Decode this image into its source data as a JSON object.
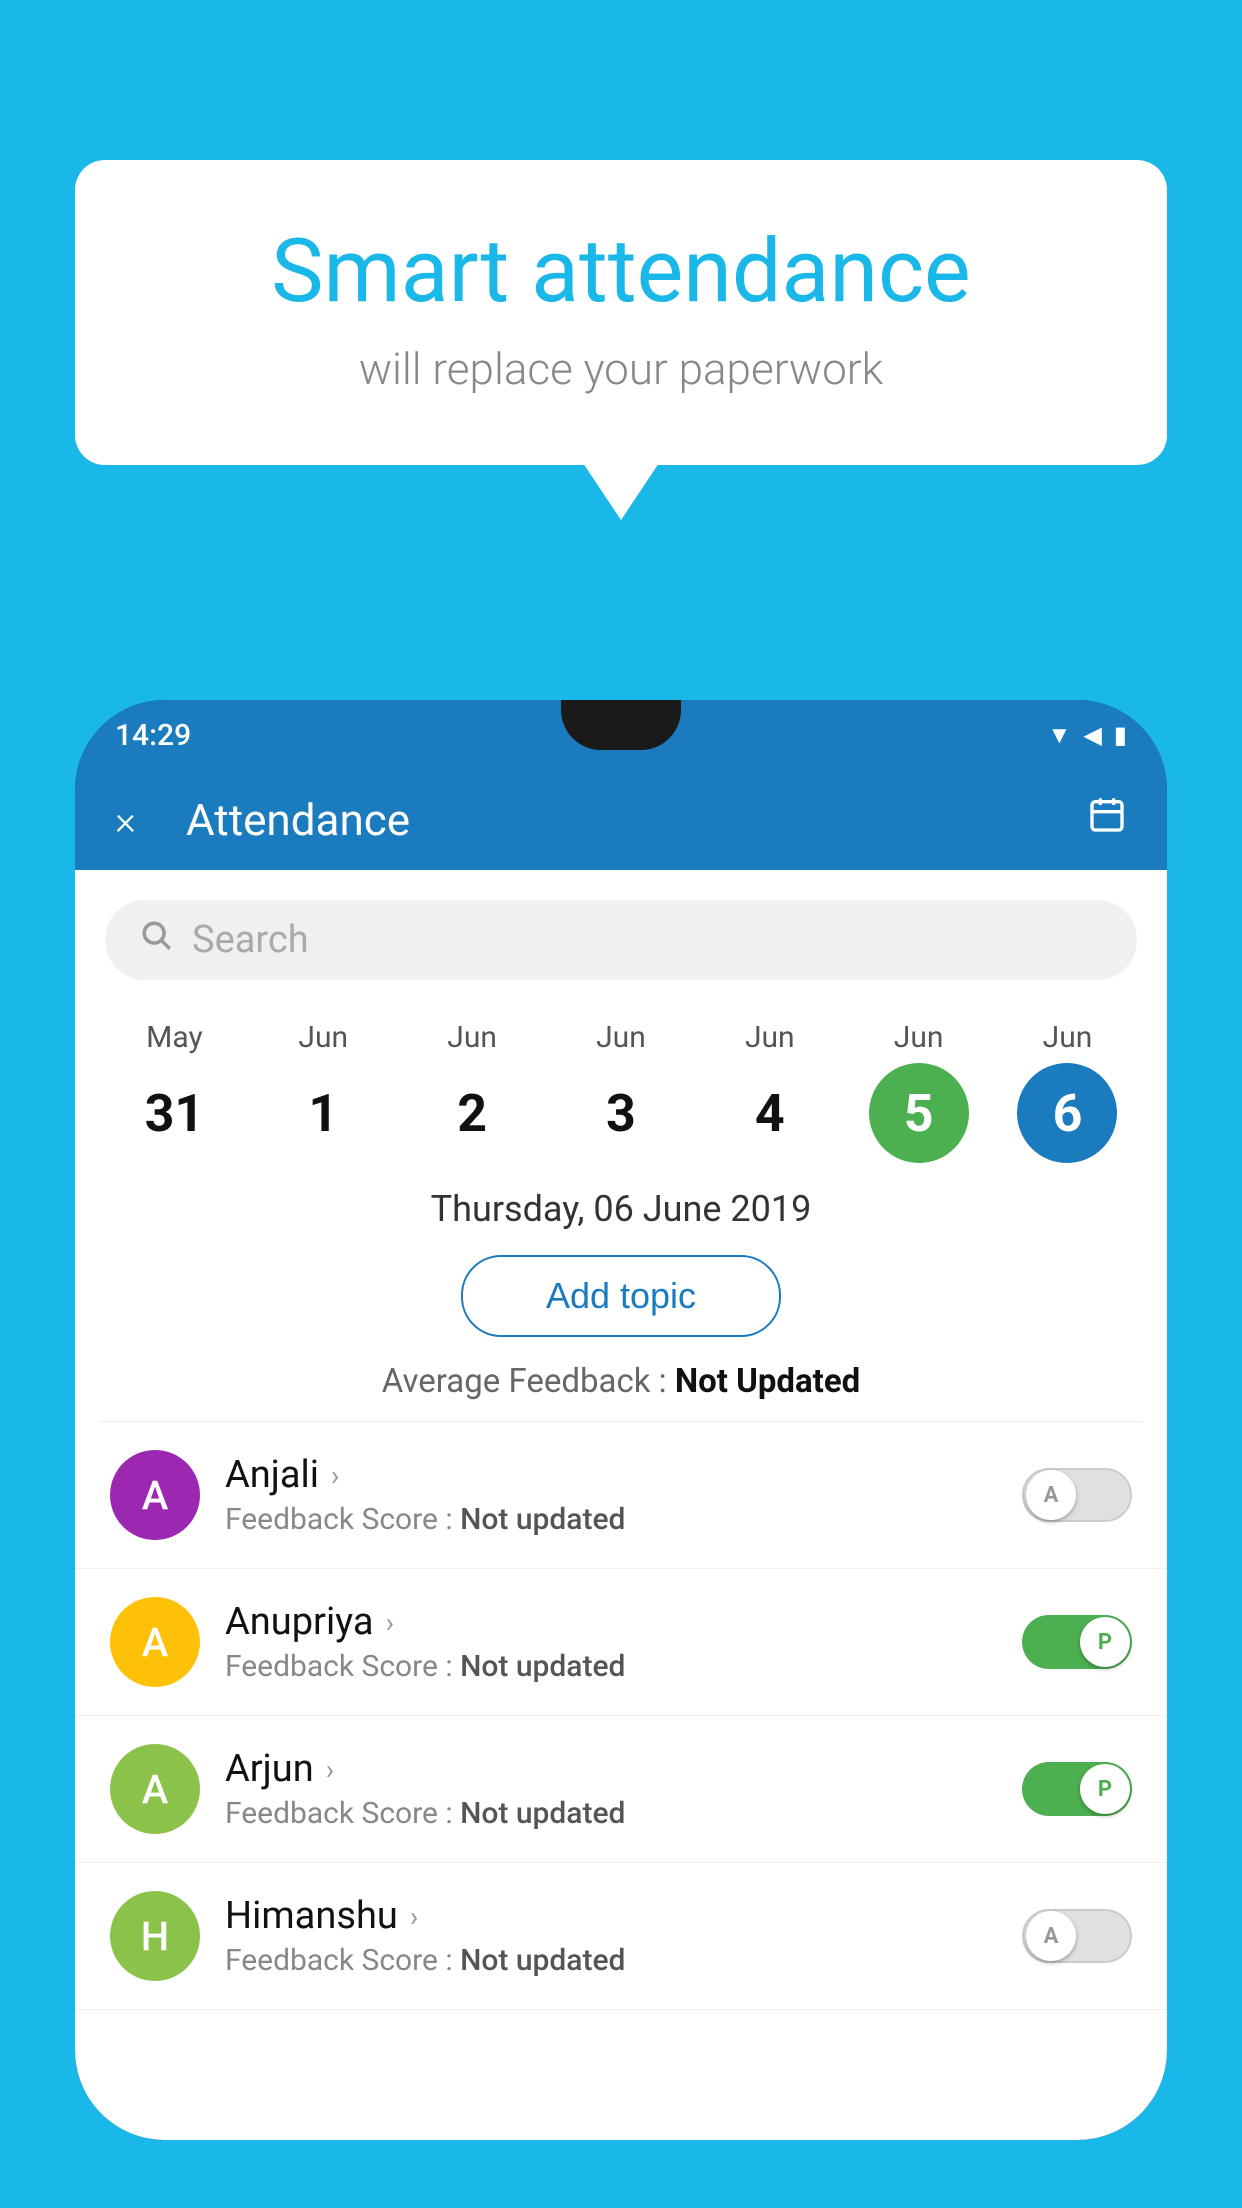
{
  "background_color": "#1ab8e8",
  "speech_bubble": {
    "title": "Smart attendance",
    "subtitle": "will replace your paperwork"
  },
  "status_bar": {
    "time": "14:29",
    "icons": [
      "wifi",
      "signal",
      "battery"
    ]
  },
  "toolbar": {
    "title": "Attendance",
    "close_label": "×",
    "calendar_icon": "📅"
  },
  "search": {
    "placeholder": "Search"
  },
  "calendar": {
    "days": [
      {
        "month": "May",
        "num": "31",
        "style": "normal"
      },
      {
        "month": "Jun",
        "num": "1",
        "style": "normal"
      },
      {
        "month": "Jun",
        "num": "2",
        "style": "normal"
      },
      {
        "month": "Jun",
        "num": "3",
        "style": "normal"
      },
      {
        "month": "Jun",
        "num": "4",
        "style": "normal"
      },
      {
        "month": "Jun",
        "num": "5",
        "style": "today"
      },
      {
        "month": "Jun",
        "num": "6",
        "style": "selected"
      }
    ]
  },
  "selected_date": "Thursday, 06 June 2019",
  "add_topic_label": "Add topic",
  "avg_feedback_label": "Average Feedback : ",
  "avg_feedback_value": "Not Updated",
  "students": [
    {
      "name": "Anjali",
      "avatar_letter": "A",
      "avatar_color": "#9c27b0",
      "feedback_label": "Feedback Score : ",
      "feedback_value": "Not updated",
      "toggle_state": "off",
      "toggle_letter": "A"
    },
    {
      "name": "Anupriya",
      "avatar_letter": "A",
      "avatar_color": "#ffc107",
      "feedback_label": "Feedback Score : ",
      "feedback_value": "Not updated",
      "toggle_state": "on",
      "toggle_letter": "P"
    },
    {
      "name": "Arjun",
      "avatar_letter": "A",
      "avatar_color": "#8bc34a",
      "feedback_label": "Feedback Score : ",
      "feedback_value": "Not updated",
      "toggle_state": "on",
      "toggle_letter": "P"
    },
    {
      "name": "Himanshu",
      "avatar_letter": "H",
      "avatar_color": "#8bc34a",
      "feedback_label": "Feedback Score : ",
      "feedback_value": "Not updated",
      "toggle_state": "off",
      "toggle_letter": "A"
    }
  ]
}
